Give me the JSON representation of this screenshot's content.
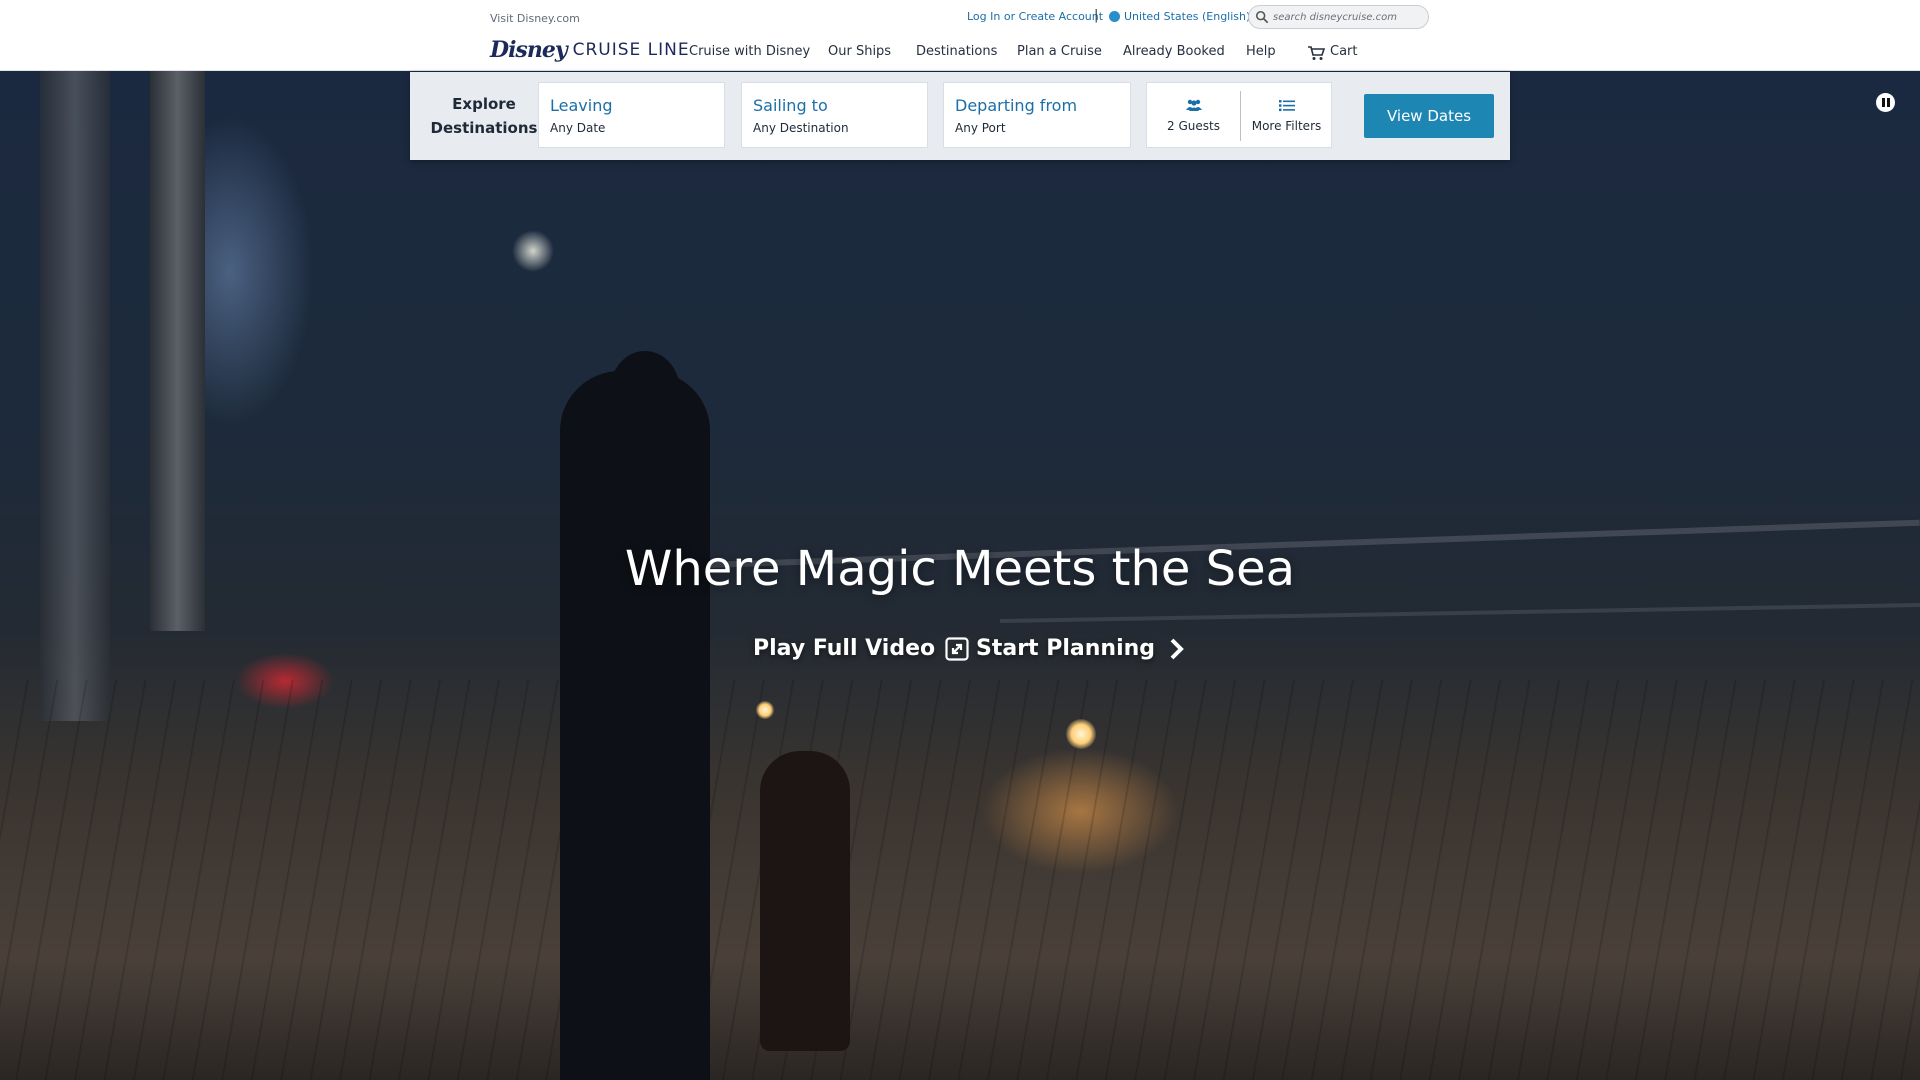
{
  "utility": {
    "visit_link": "Visit Disney.com",
    "login_link": "Log In or Create Account",
    "separator": "|",
    "locale": "United States (English)",
    "search_placeholder": "search disneycruise.com"
  },
  "brand": {
    "logo_disney": "Disney",
    "logo_cruise_line": "CRUISE LINE",
    "color_navy": "#1c2a5a",
    "color_link": "#1b6fa8"
  },
  "nav": {
    "items": [
      "Cruise with Disney",
      "Our Ships",
      "Destinations",
      "Plan a Cruise",
      "Already Booked",
      "Help"
    ],
    "cart_label": "Cart",
    "cart_icon": "cart-icon"
  },
  "finder": {
    "title_line1": "Explore",
    "title_line2": "Destinations",
    "fields": [
      {
        "label": "Leaving",
        "value": "Any Date"
      },
      {
        "label": "Sailing to",
        "value": "Any Destination"
      },
      {
        "label": "Departing from",
        "value": "Any Port"
      }
    ],
    "guests_label": "2 Guests",
    "guests_icon": "guests-icon",
    "filters_label": "More Filters",
    "filters_icon": "list-icon",
    "submit_label": "View Dates",
    "submit_color": "#1e86b3"
  },
  "hero": {
    "title": "Where Magic Meets the Sea",
    "cta_video": "Play Full Video",
    "cta_video_icon": "expand-icon",
    "cta_planning": "Start Planning",
    "cta_planning_icon": "chevron-right-icon",
    "pause_icon": "pause-icon"
  }
}
